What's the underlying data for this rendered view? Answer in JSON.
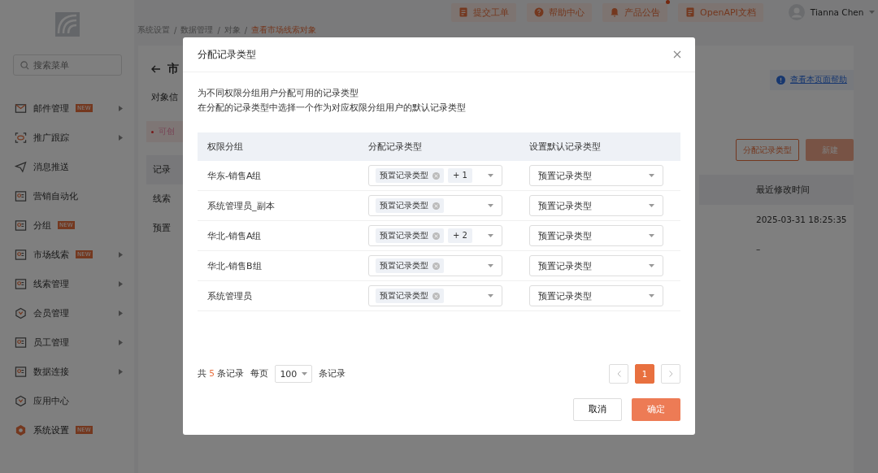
{
  "topbar": {
    "links": [
      {
        "label": "提交工单",
        "dot": false
      },
      {
        "label": "帮助中心",
        "dot": false
      },
      {
        "label": "产品公告",
        "dot": true
      },
      {
        "label": "OpenAPI文档",
        "dot": false
      }
    ],
    "user": {
      "name": "Tianna Chen"
    }
  },
  "sidebar": {
    "search": {
      "placeholder": "搜索菜单"
    },
    "items": [
      {
        "label": "邮件管理",
        "new": "NEW",
        "submenu": true,
        "selected": false
      },
      {
        "label": "推广跟踪",
        "submenu": true,
        "selected": false
      },
      {
        "label": "消息推送",
        "submenu": false,
        "selected": false
      },
      {
        "label": "营销自动化",
        "submenu": false,
        "selected": false
      },
      {
        "label": "分组",
        "new": "NEW",
        "submenu": false,
        "selected": false
      },
      {
        "label": "市场线索",
        "new": "NEW",
        "submenu": true,
        "selected": false
      },
      {
        "label": "线索管理",
        "submenu": true,
        "selected": false
      },
      {
        "label": "会员管理",
        "submenu": true,
        "selected": false
      },
      {
        "label": "员工管理",
        "submenu": true,
        "selected": false
      },
      {
        "label": "数据连接",
        "submenu": true,
        "selected": false
      },
      {
        "label": "应用中心",
        "submenu": false,
        "selected": false
      },
      {
        "label": "系统设置",
        "new": "NEW",
        "submenu": false,
        "selected": true
      }
    ]
  },
  "breadcrumb_separator": "/",
  "breadcrumb": [
    {
      "label": "系统设置",
      "current": false
    },
    {
      "label": "数据管理",
      "current": false
    },
    {
      "label": "对象",
      "current": false
    },
    {
      "label": "查看市场线索对象",
      "current": true
    }
  ],
  "page": {
    "title": "市",
    "tab": "对象信",
    "alert": "可创",
    "table_header": "记录",
    "rows": [
      "线索",
      "预置"
    ],
    "help_link": "查看本页面帮助",
    "assign_button": "分配记录类型",
    "new_button": "新建",
    "column": "最近修改时间",
    "times": [
      "2025-03-31 18:25:35",
      "–"
    ]
  },
  "dialog": {
    "title": "分配记录类型",
    "description": [
      "为不同权限分组用户分配可用的记录类型",
      "在分配的记录类型中选择一个作为对应权限分组用户的默认记录类型"
    ],
    "columns": [
      "权限分组",
      "分配记录类型",
      "设置默认记录类型"
    ],
    "rows": [
      {
        "group": "华东-销售A组",
        "types": [
          "预置记录类型"
        ],
        "more": "+ 1",
        "default": "预置记录类型"
      },
      {
        "group": "系统管理员_副本",
        "types": [
          "预置记录类型"
        ],
        "default": "预置记录类型"
      },
      {
        "group": "华北-销售A组",
        "types": [
          "预置记录类型"
        ],
        "more": "+ 2",
        "default": "预置记录类型"
      },
      {
        "group": "华北-销售B组",
        "types": [
          "预置记录类型"
        ],
        "default": "预置记录类型"
      },
      {
        "group": "系统管理员",
        "types": [
          "预置记录类型"
        ],
        "default": "预置记录类型"
      }
    ],
    "footer": {
      "total_prefix": "共",
      "total": "5",
      "total_suffix": "条记录",
      "per_page_label": "每页",
      "per_page": "100",
      "per_page_suffix": "条记录",
      "pages": [
        {
          "label": "1",
          "selected": true
        }
      ]
    },
    "buttons": {
      "cancel": "取消",
      "ok": "确定"
    }
  }
}
